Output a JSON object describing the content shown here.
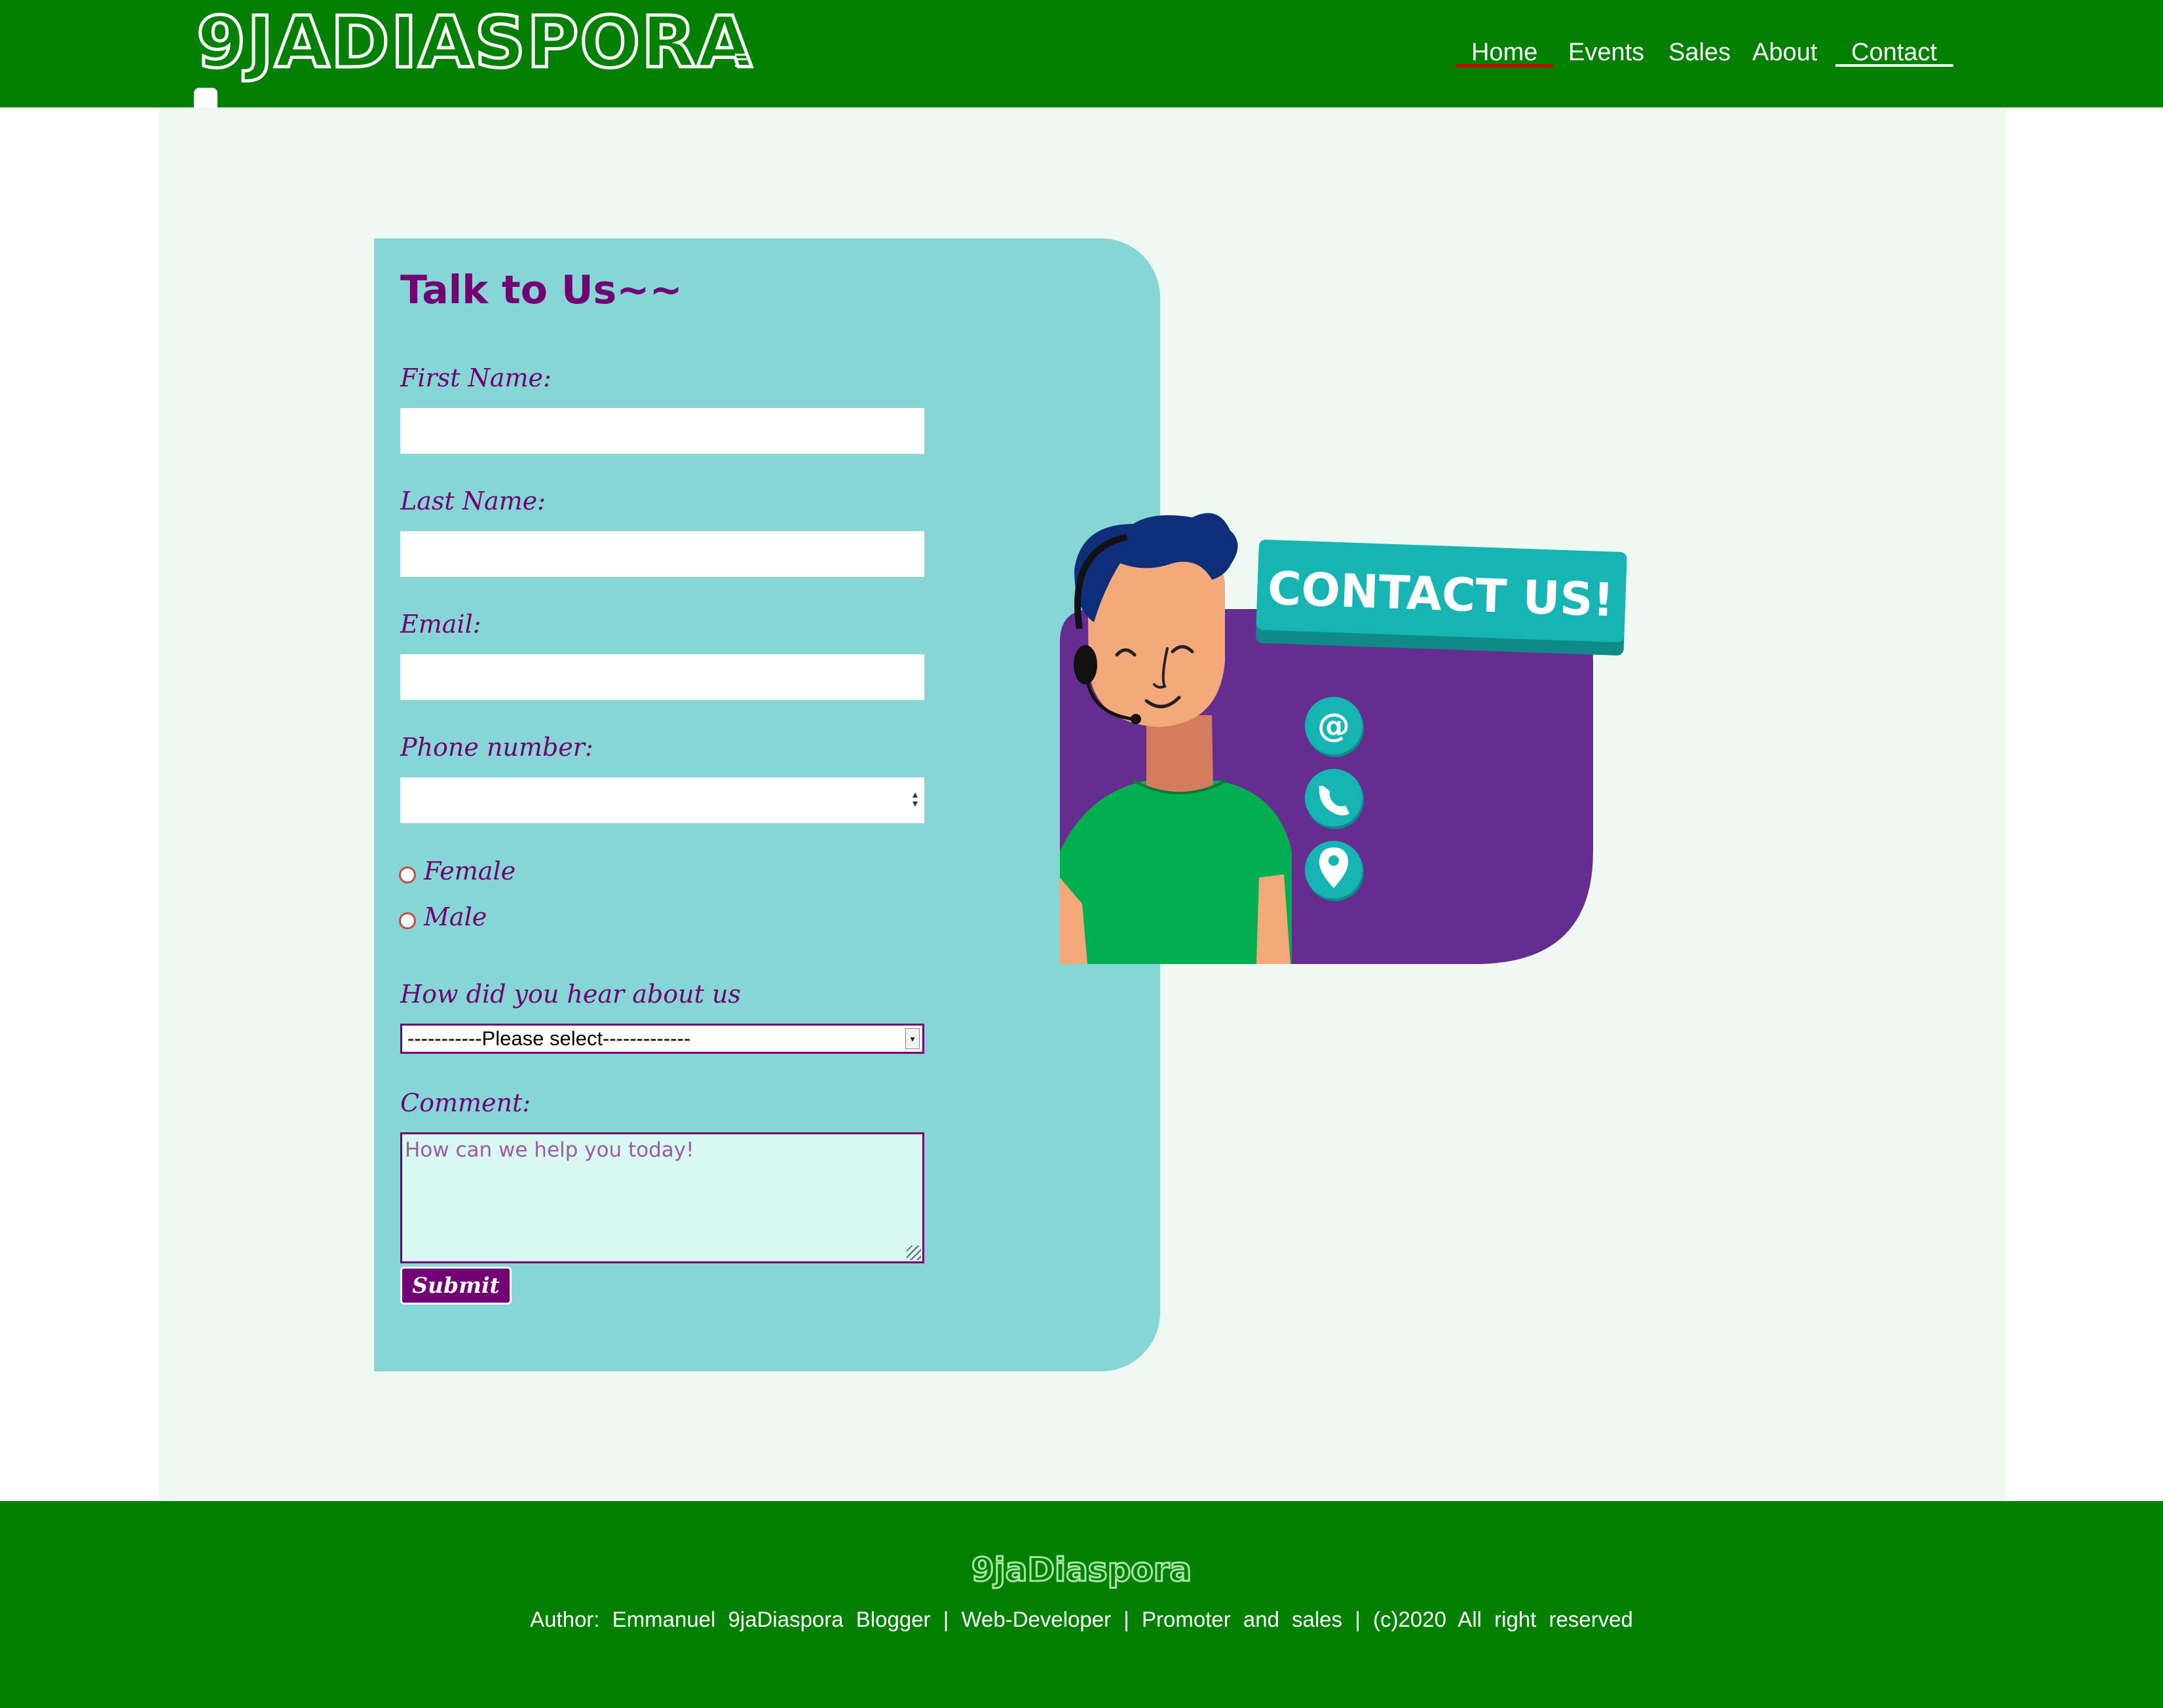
{
  "header": {
    "logo_text": "9JADIASPORA",
    "nav": {
      "home": "Home",
      "events": "Events",
      "sales": "Sales",
      "about": "About",
      "contact": "Contact"
    }
  },
  "form": {
    "title": "Talk to Us~~",
    "first_name_label": "First Name:",
    "first_name_value": "",
    "last_name_label": "Last Name:",
    "last_name_value": "",
    "email_label": "Email:",
    "email_value": "",
    "phone_label": "Phone number:",
    "phone_value": "",
    "gender_options": [
      "Female",
      "Male"
    ],
    "hear_label": "How did you hear about us",
    "hear_selected": "-----------Please select-------------",
    "comment_label": "Comment:",
    "comment_placeholder": "How can we help you today!",
    "submit_label": "Submit"
  },
  "illustration": {
    "badge_text": "CONTACT US!",
    "icons": [
      "at-icon",
      "phone-icon",
      "location-pin-icon"
    ]
  },
  "footer": {
    "logo_text": "9jaDiaspora",
    "credits": "Author: Emmanuel 9jaDiaspora Blogger | Web-Developer | Promoter and sales | (c)2020 All right reserved"
  },
  "colors": {
    "header_green": "#018001",
    "main_bg": "#eefaf1",
    "form_bg": "#87d6d6",
    "accent_purple": "#720174",
    "illus_purple": "#662d91",
    "badge_teal": "#16b5b3",
    "shirt_green": "#00b050",
    "nav_active_underline": "#d00000"
  }
}
